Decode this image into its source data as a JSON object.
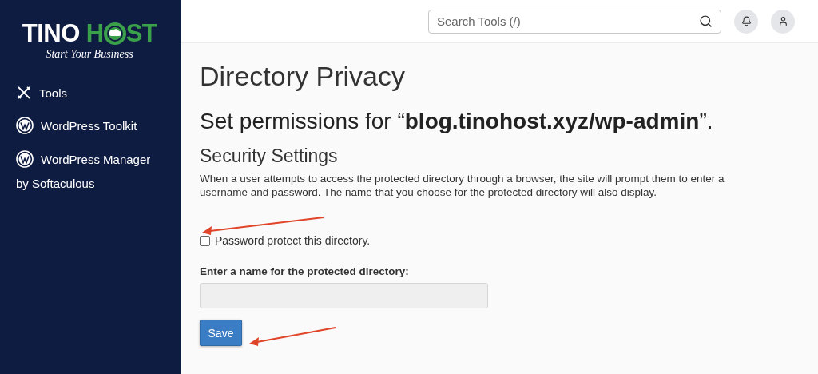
{
  "logo": {
    "brand_first": "TINO",
    "brand_second_start": "H",
    "brand_second_end": "ST",
    "tagline": "Start Your Business"
  },
  "sidebar": {
    "items": [
      {
        "label": "Tools",
        "kind": "tools"
      },
      {
        "label": "WordPress Toolkit",
        "kind": "wordpress"
      },
      {
        "label": "WordPress Manager",
        "kind": "wordpress",
        "second_line": "by Softaculous"
      }
    ]
  },
  "header": {
    "search": {
      "placeholder": "Search Tools (/)"
    }
  },
  "page": {
    "title": "Directory Privacy",
    "subtitle": "Set permissions for “**blog.tinohost.xyz/wp-admin**”.",
    "section_title": "Security Settings",
    "description": "When a user attempts to access the protected directory through a browser, the site will prompt them to enter a username and password. The name that you choose for the protected directory will also display.",
    "protect_checkbox": {
      "label": "Password protect this directory.",
      "checked": false
    },
    "name_field": {
      "label": "Enter a name for the protected directory:",
      "disabled": true
    },
    "save_button": "Save"
  }
}
